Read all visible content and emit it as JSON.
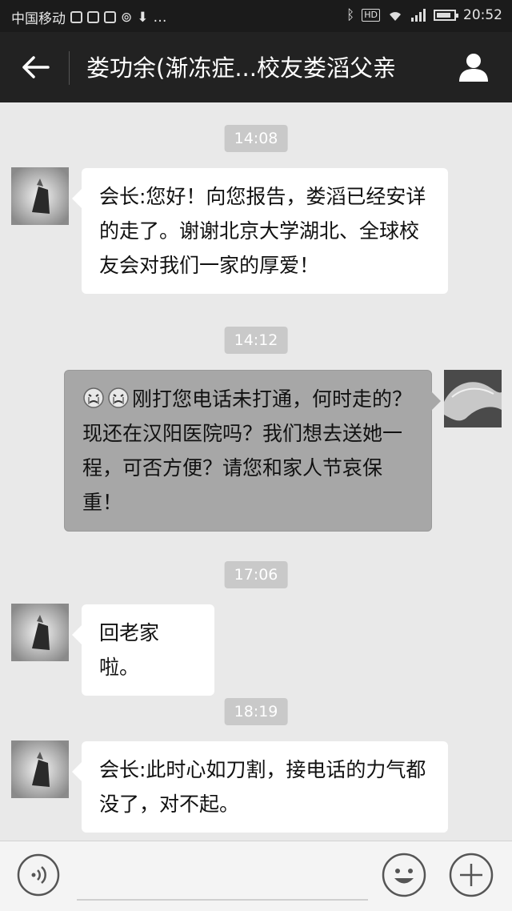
{
  "status_bar": {
    "carrier": "中国移动",
    "time": "20:52"
  },
  "header": {
    "title": "娄功余(渐冻症...校友娄滔父亲"
  },
  "messages": [
    {
      "type": "time",
      "text": "14:08"
    },
    {
      "type": "incoming",
      "text": "会长:您好！向您报告，娄滔已经安详的走了。谢谢北京大学湖北、全球校友会对我们一家的厚爱！"
    },
    {
      "type": "time",
      "text": "14:12"
    },
    {
      "type": "outgoing",
      "text": "刚打您电话未打通，何时走的？现还在汉阳医院吗？我们想去送她一程，可否方便？请您和家人节哀保重！"
    },
    {
      "type": "time",
      "text": "17:06"
    },
    {
      "type": "incoming",
      "text": "回老家啦。"
    },
    {
      "type": "time",
      "text": "18:19"
    },
    {
      "type": "incoming",
      "text": "会长:此时心如刀割，接电话的力气都没了，对不起。"
    }
  ],
  "input_bar": {
    "placeholder": ""
  },
  "colors": {
    "header_bg": "#222222",
    "chat_bg": "#e9e9e9",
    "incoming_bubble": "#ffffff",
    "outgoing_bubble": "#a7a7a7"
  }
}
